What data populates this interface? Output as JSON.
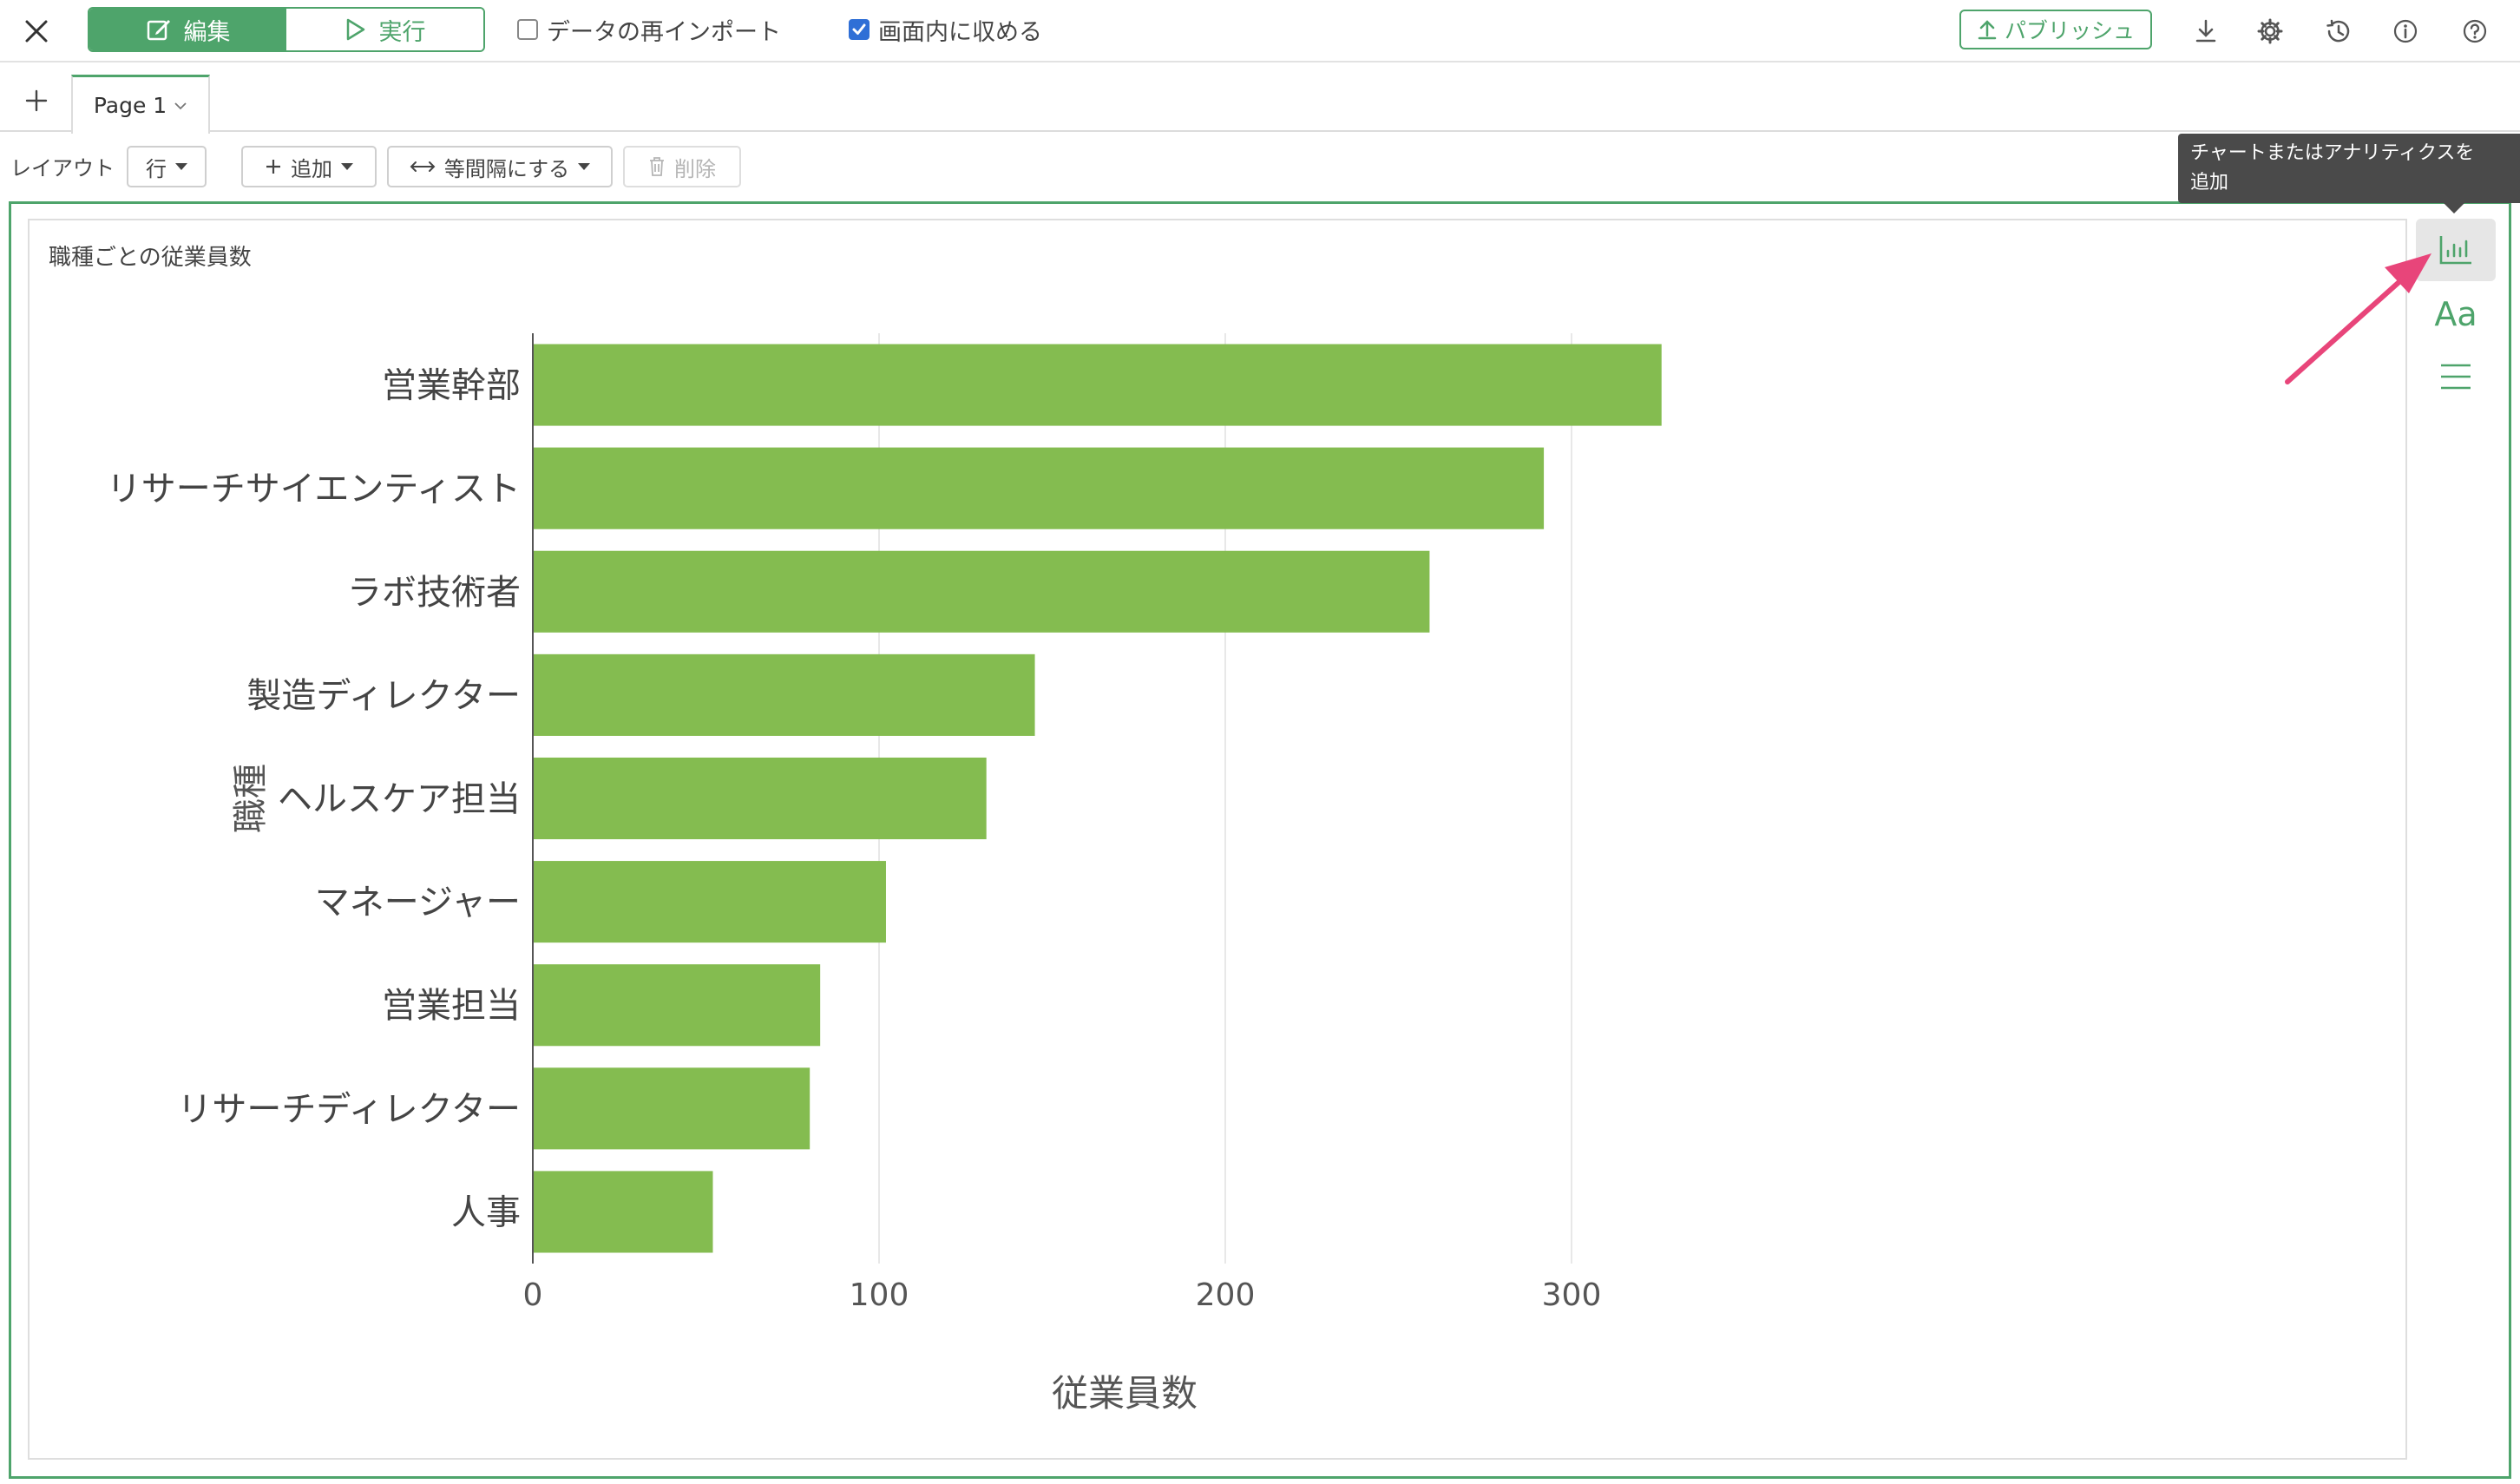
{
  "toolbar": {
    "edit_label": "編集",
    "run_label": "実行",
    "reimport_label": "データの再インポート",
    "fit_label": "画面内に収める",
    "fit_checked": true,
    "reimport_checked": false,
    "publish_label": "パブリッシュ",
    "icons": [
      "close-icon",
      "download-icon",
      "gear-icon",
      "history-icon",
      "info-icon",
      "help-icon"
    ]
  },
  "pages": {
    "tabs": [
      {
        "label": "Page 1"
      }
    ]
  },
  "layout_bar": {
    "label": "レイアウト",
    "row_label": "行",
    "add_label": "追加",
    "equal_spacing_label": "等間隔にする",
    "delete_label": "削除"
  },
  "tooltip": {
    "text_line1": "チャートまたはアナリティクスを",
    "text_line2": "追加"
  },
  "colors": {
    "accent": "#4ea46b",
    "bar": "#84bc50",
    "tooltip_bg": "#4a4a4a",
    "arrow": "#e8457a"
  },
  "chart_data": {
    "type": "bar",
    "orientation": "horizontal",
    "title": "職種ごとの従業員数",
    "xlabel": "従業員数",
    "ylabel": "職種",
    "categories": [
      "営業幹部",
      "リサーチサイエンティスト",
      "ラボ技術者",
      "製造ディレクター",
      "ヘルスケア担当",
      "マネージャー",
      "営業担当",
      "リサーチディレクター",
      "人事"
    ],
    "values": [
      326,
      292,
      259,
      145,
      131,
      102,
      83,
      80,
      52
    ],
    "xlim": [
      0,
      340
    ],
    "xticks": [
      0,
      100,
      200,
      300
    ],
    "grid": true
  }
}
